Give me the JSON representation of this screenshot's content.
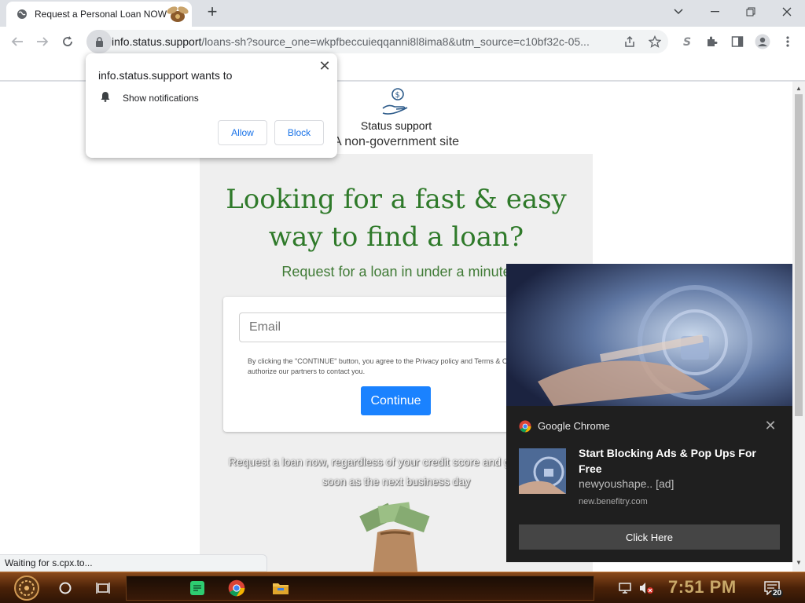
{
  "browser": {
    "tab": {
      "title": "Request a Personal Loan NOW"
    },
    "url": {
      "host": "info.status.support",
      "path": "/loans-sh?source_one=wkpfbeccuieqqanni8l8ima8&utm_source=c10bf32c-05..."
    },
    "status_text": "Waiting for s.cpx.to..."
  },
  "permission_prompt": {
    "title": "info.status.support wants to",
    "permission": "Show notifications",
    "allow_label": "Allow",
    "block_label": "Block"
  },
  "page": {
    "site_name": "Status support",
    "tagline": "A non-government site",
    "headline_line1": "Looking for a fast & easy",
    "headline_line2": "way to find a loan?",
    "subhead": "Request for a loan in under a minute",
    "email_placeholder": "Email",
    "terms": "By clicking the \"CONTINUE\" button, you agree to the Privacy policy and Terms & Conditions and authorize our partners to contact you.",
    "continue_label": "Continue",
    "disclaimer": "Request a loan now, regardless of your credit score and get funds as soon as the next business day"
  },
  "notification": {
    "app": "Google Chrome",
    "title": "Start Blocking Ads & Pop Ups For Free",
    "body": "newyoushape.. [ad]",
    "domain": "new.benefitry.com",
    "action_label": "Click Here"
  },
  "taskbar": {
    "time": "7:51 PM",
    "notification_count": "20"
  },
  "colors": {
    "headline": "#2f7a2a",
    "continue": "#1a82ff",
    "toast_bg": "#1f1f1f",
    "taskbar": "#4b2208"
  }
}
